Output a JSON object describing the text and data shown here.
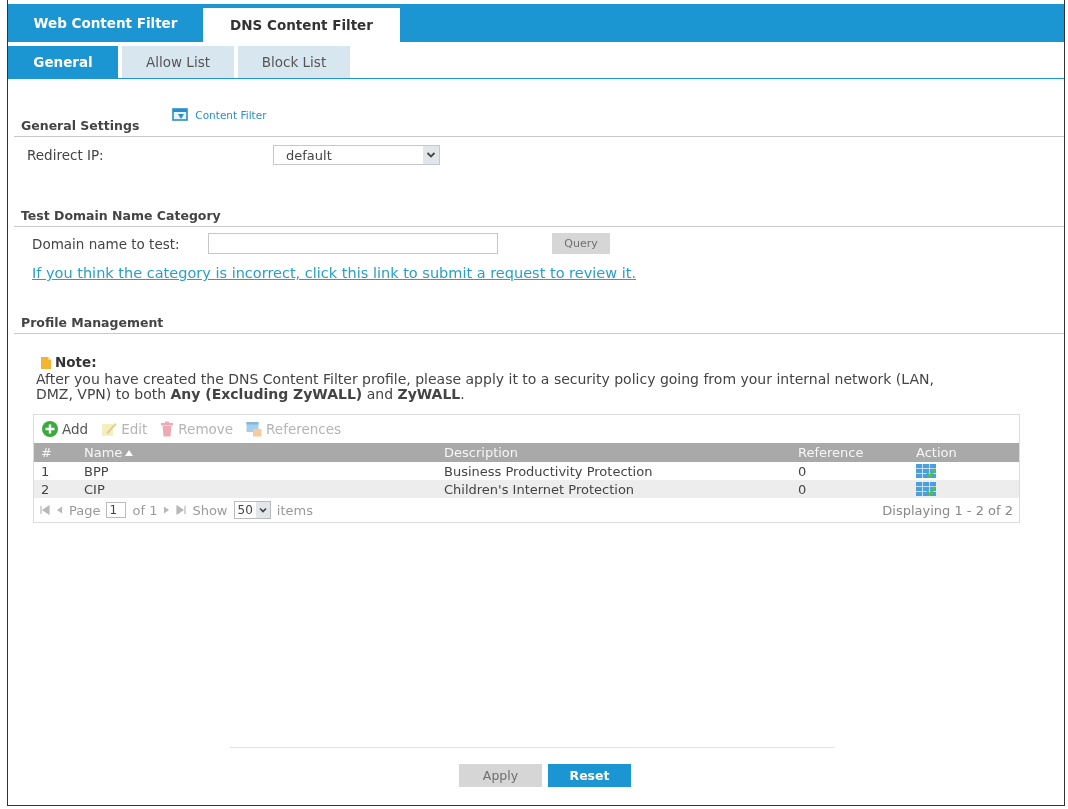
{
  "main_tabs": [
    {
      "label": "Web Content Filter",
      "selected": false
    },
    {
      "label": "DNS Content Filter",
      "selected": true
    }
  ],
  "sub_tabs": [
    {
      "label": "General",
      "selected": true
    },
    {
      "label": "Allow List",
      "selected": false
    },
    {
      "label": "Block List",
      "selected": false
    }
  ],
  "general_settings": {
    "heading": "General Settings",
    "link": "Content Filter",
    "redirect_ip": {
      "label": "Redirect IP:",
      "value": "default"
    }
  },
  "test_domain": {
    "heading": "Test Domain Name Category",
    "field_label": "Domain name to test:",
    "query_button": {
      "label": "Query",
      "disabled": true
    },
    "review_link": "If you think the category is incorrect, click this link to submit a request to review it."
  },
  "profile_management": {
    "heading": "Profile Management",
    "note": {
      "title": "Note:",
      "text": "After you have created the DNS Content Filter profile, please apply it to a security policy going from your internal network (LAN, DMZ, VPN) to both **Any (Excluding ZyWALL)** and **ZyWALL**."
    },
    "toolbar": [
      {
        "kind": "add",
        "label": "Add",
        "disabled": false
      },
      {
        "kind": "edit",
        "label": "Edit",
        "disabled": true
      },
      {
        "kind": "remove",
        "label": "Remove",
        "disabled": true
      },
      {
        "kind": "references",
        "label": "References",
        "disabled": true
      }
    ],
    "table": {
      "columns": [
        {
          "label": "#",
          "sorted_ascending": false
        },
        {
          "label": "Name",
          "sorted_ascending": true
        },
        {
          "label": "Description",
          "sorted_ascending": false
        },
        {
          "label": "Reference",
          "sorted_ascending": false
        },
        {
          "label": "Action",
          "sorted_ascending": false
        }
      ],
      "rows": [
        {
          "number": "1",
          "name": "BPP",
          "description": "Business Productivity Protection",
          "reference": "0"
        },
        {
          "number": "2",
          "name": "CIP",
          "description": "Children's Internet Protection",
          "reference": "0"
        }
      ]
    },
    "pager": {
      "page_label": "Page",
      "page": "1",
      "of_label": "of 1",
      "show_label": "Show",
      "per_page": "50",
      "items_label": "items",
      "summary": "Displaying 1 - 2 of 2"
    }
  },
  "buttons": [
    {
      "label": "Apply",
      "disabled": true
    },
    {
      "label": "Reset",
      "disabled": false
    }
  ]
}
